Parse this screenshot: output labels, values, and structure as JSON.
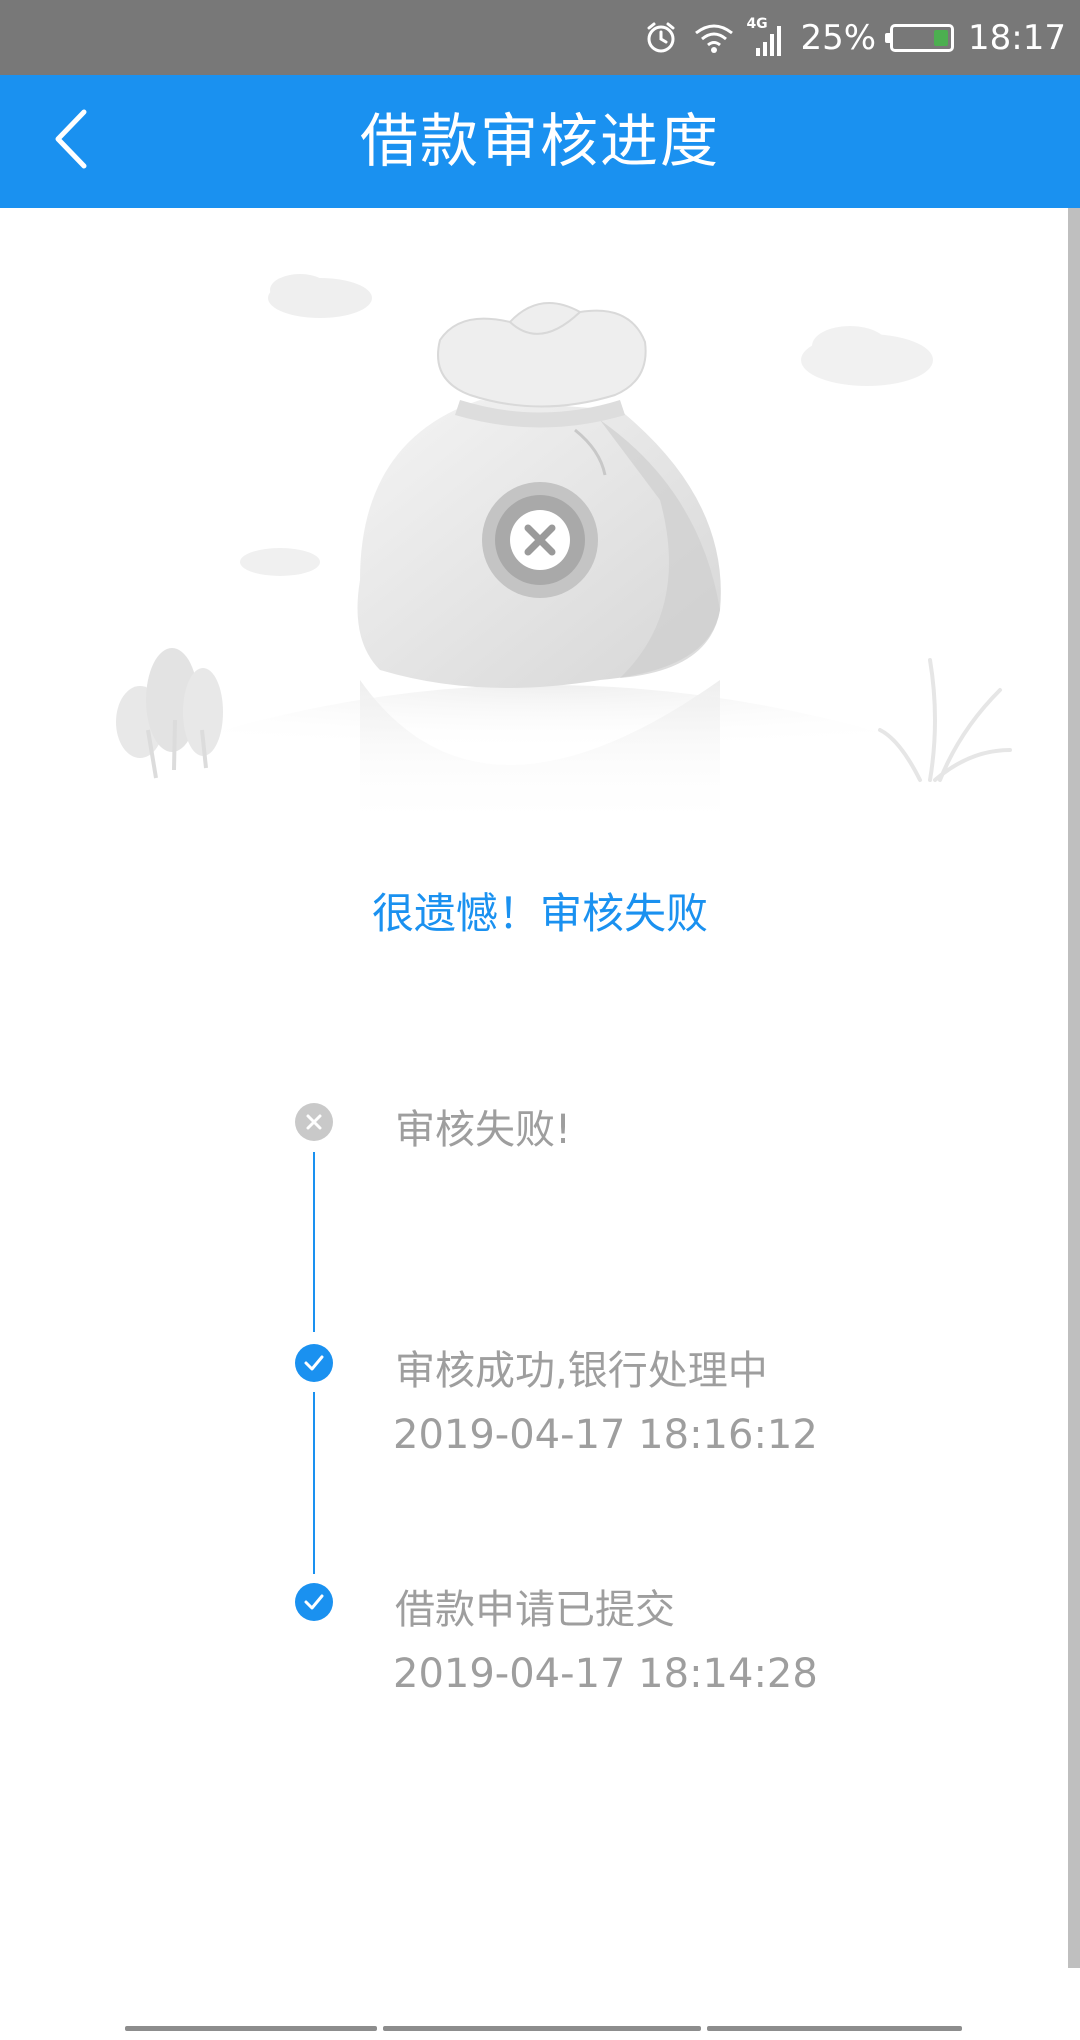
{
  "status_bar": {
    "network": "4G",
    "battery": "25%",
    "time": "18:17",
    "icons": [
      "alarm-icon",
      "wifi-icon",
      "signal-icon",
      "battery-icon"
    ],
    "battery_level": 0.25
  },
  "app_bar": {
    "title": "借款审核进度",
    "back_icon": "chevron-left-icon",
    "color": "#1a91f0"
  },
  "illustration": {
    "icon": "money-bag-failed-icon"
  },
  "result": {
    "message": "很遗憾！审核失败"
  },
  "timeline": [
    {
      "status": "failed",
      "icon": "x-circle-icon",
      "title": "审核失败!",
      "time": ""
    },
    {
      "status": "done",
      "icon": "check-circle-icon",
      "title": "审核成功,银行处理中",
      "time": "2019-04-17 18:16:12"
    },
    {
      "status": "done",
      "icon": "check-circle-icon",
      "title": "借款申请已提交",
      "time": "2019-04-17 18:14:28"
    }
  ],
  "colors": {
    "accent": "#1a91f0",
    "status_bar": "#787878",
    "muted_text": "#9e9e9e"
  }
}
